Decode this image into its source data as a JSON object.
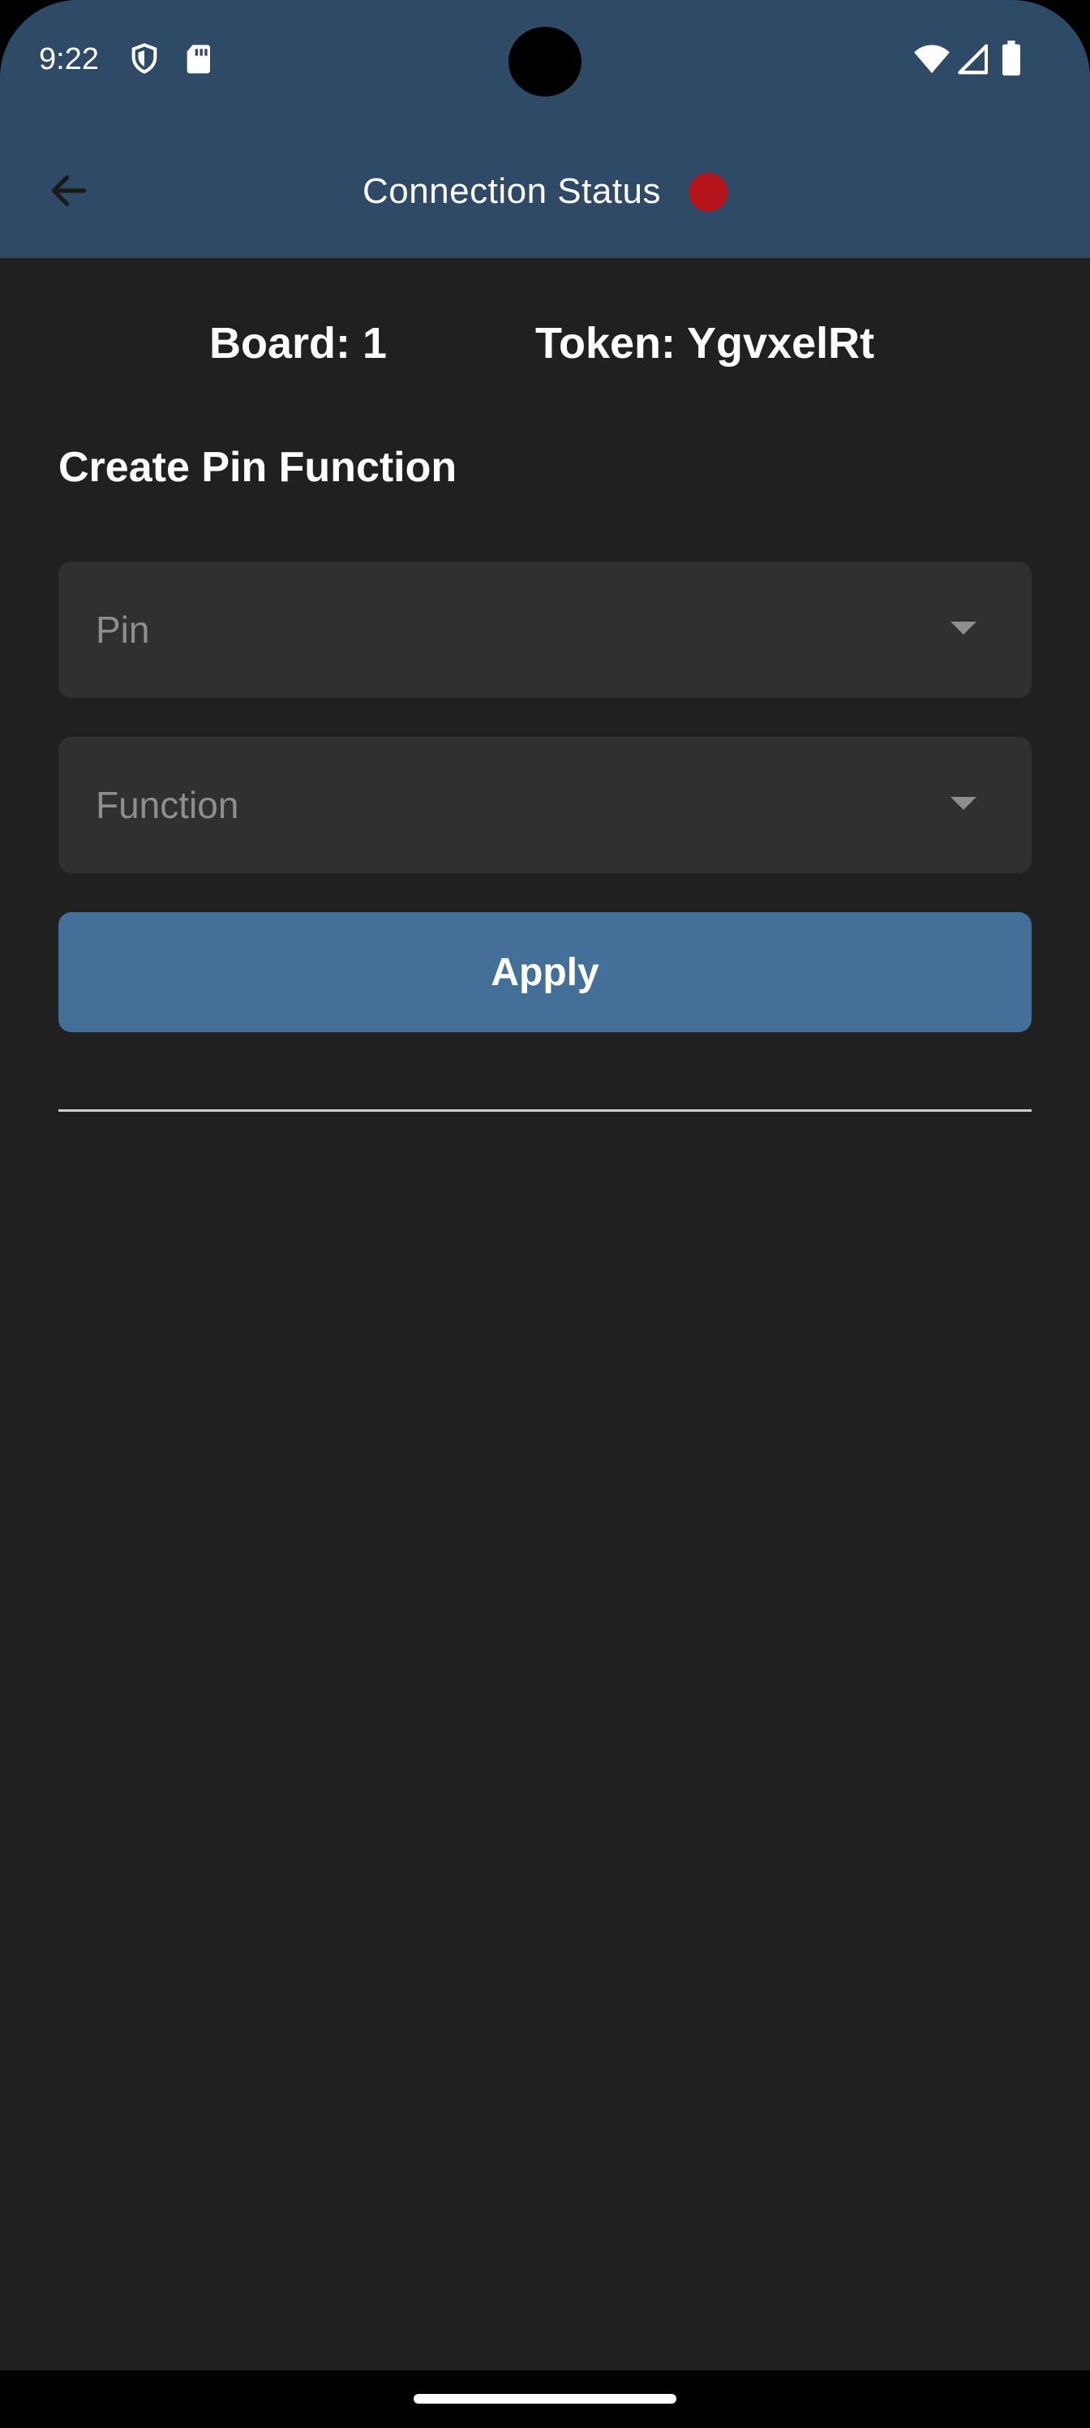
{
  "status_bar": {
    "time": "9:22",
    "icons": [
      "shield-icon",
      "sd-card-icon",
      "wifi-icon",
      "signal-icon",
      "battery-icon"
    ]
  },
  "app_bar": {
    "title": "Connection Status",
    "back_icon": "arrow-back-icon",
    "status_dot_color": "#b3151b",
    "background_color": "#2e4a66"
  },
  "info": {
    "board": "Board: 1",
    "token": "Token: YgvxelRt"
  },
  "section": {
    "title": "Create Pin Function"
  },
  "form": {
    "pin_placeholder": "Pin",
    "function_placeholder": "Function",
    "apply_label": "Apply",
    "apply_color": "#436f99"
  }
}
